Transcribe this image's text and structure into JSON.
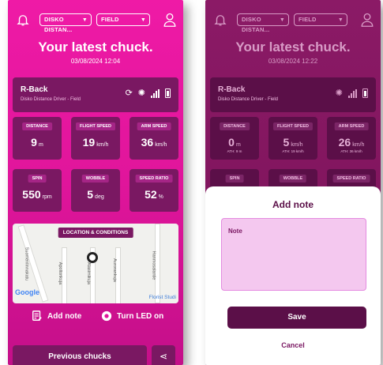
{
  "left": {
    "disc_select": "DISKO DISTAN...",
    "mode_select": "FIELD",
    "title": "Your latest chuck.",
    "date": "03/08/2024 12:04",
    "disc": {
      "name": "R-Back",
      "subtitle": "Disko Distance Driver - Field"
    },
    "stats": [
      {
        "label": "DISTANCE",
        "value": "9",
        "unit": "m"
      },
      {
        "label": "FLIGHT SPEED",
        "value": "19",
        "unit": "km/h"
      },
      {
        "label": "ARM SPEED",
        "value": "36",
        "unit": "km/h"
      },
      {
        "label": "SPIN",
        "value": "550",
        "unit": "rpm"
      },
      {
        "label": "WOBBLE",
        "value": "5",
        "unit": "deg"
      },
      {
        "label": "SPEED RATIO",
        "value": "52",
        "unit": "%"
      }
    ],
    "map": {
      "badge": "LOCATION & CONDITIONS",
      "google": "Google",
      "place": "Florist Studi",
      "roads": [
        "Suomenlinnakatu",
        "Apollonkuja",
        "Alasimikuja",
        "Aurorankuja",
        "Hanmosalantie"
      ]
    },
    "actions": {
      "add_note": "Add note",
      "led": "Turn LED on"
    },
    "previous": "Previous chucks"
  },
  "right": {
    "disc_select": "DISKO DISTAN...",
    "mode_select": "FIELD",
    "title": "Your latest chuck.",
    "date": "03/08/2024 12:22",
    "disc": {
      "name": "R-Back",
      "subtitle": "Disko Distance Driver - Field"
    },
    "stats": [
      {
        "label": "DISTANCE",
        "value": "0",
        "unit": "m",
        "sub": "ATH: 9 m"
      },
      {
        "label": "FLIGHT SPEED",
        "value": "5",
        "unit": "km/h",
        "sub": "ATH: 19 km/h"
      },
      {
        "label": "ARM SPEED",
        "value": "26",
        "unit": "km/h",
        "sub": "ATH: 36 km/h"
      },
      {
        "label": "SPIN"
      },
      {
        "label": "WOBBLE"
      },
      {
        "label": "SPEED RATIO"
      }
    ],
    "modal": {
      "title": "Add note",
      "field_label": "Note",
      "save": "Save",
      "cancel": "Cancel"
    }
  },
  "colors": {
    "magenta": "#e0159b",
    "card": "#7a1862",
    "dark": "#5b0f48",
    "note_bg": "#f4c8ef"
  }
}
